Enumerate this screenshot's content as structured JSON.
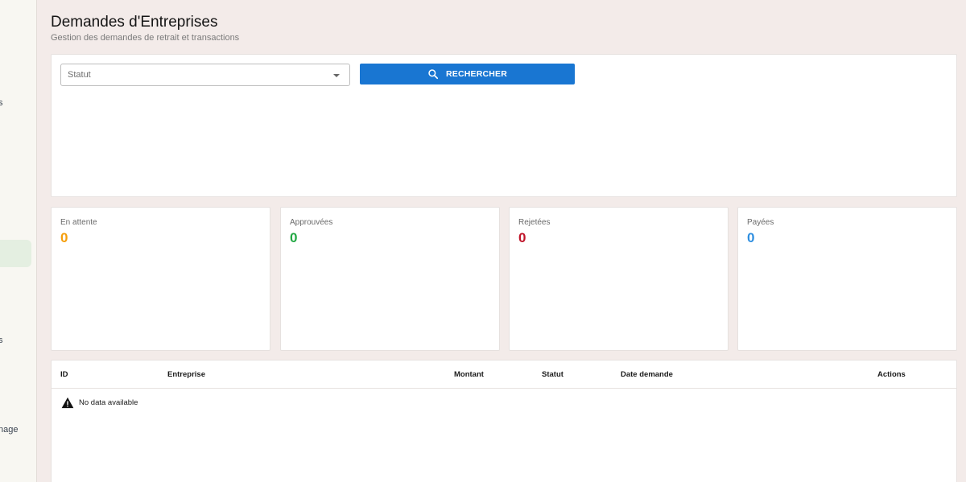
{
  "sidebar": {
    "fragments": [
      "s",
      "s",
      "nage"
    ]
  },
  "header": {
    "title": "Demandes d'Entreprises",
    "subtitle": "Gestion des demandes de retrait et transactions"
  },
  "filters": {
    "status_label": "Statut",
    "search_label": "RECHERCHER"
  },
  "stats": [
    {
      "label": "En attente",
      "value": "0",
      "color": "#f59e0b"
    },
    {
      "label": "Approuvées",
      "value": "0",
      "color": "#22a843"
    },
    {
      "label": "Rejetées",
      "value": "0",
      "color": "#c0152a"
    },
    {
      "label": "Payées",
      "value": "0",
      "color": "#2f8fe0"
    }
  ],
  "table": {
    "columns": [
      "ID",
      "Entreprise",
      "Montant",
      "Statut",
      "Date demande",
      "Actions"
    ],
    "empty_message": "No data available"
  },
  "colors": {
    "accent": "#1976d2",
    "background": "#f3ebe9"
  }
}
